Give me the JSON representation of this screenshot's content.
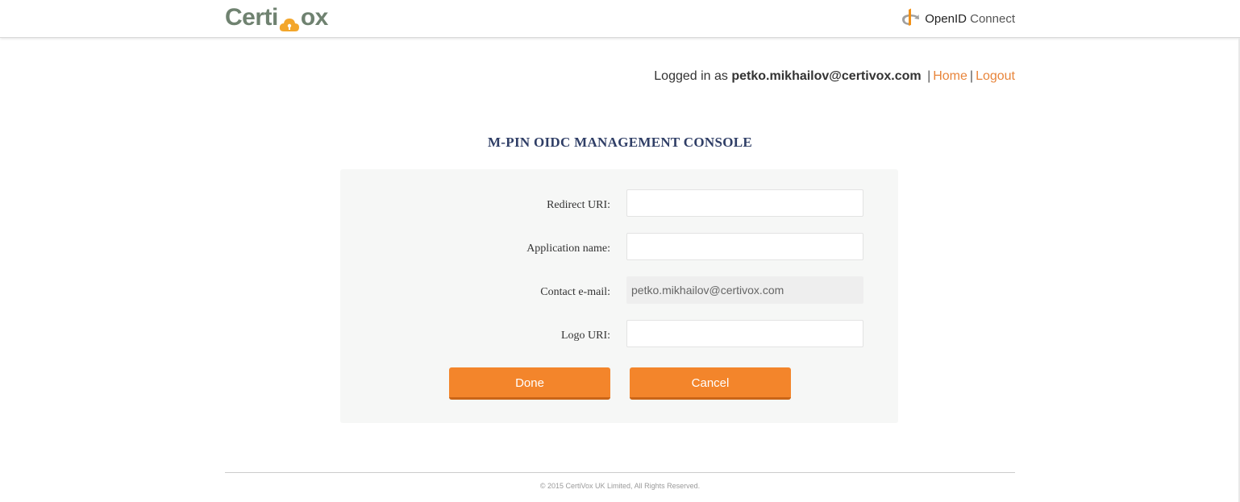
{
  "header": {
    "brand_prefix": "Certi",
    "brand_suffix": "ox",
    "brand_cloud_letter": "V",
    "brand_color": "#6f8270",
    "cloud_color": "#f3a62b",
    "openid_strong": "OpenID",
    "openid_light": "Connect"
  },
  "userbar": {
    "logged_in_prefix": "Logged in as",
    "user_email": "petko.mikhailov@certivox.com",
    "separator": "|",
    "home_link": "Home",
    "logout_link": "Logout",
    "link_color": "#e8853b"
  },
  "page": {
    "title": "M-PIN OIDC MANAGEMENT CONSOLE"
  },
  "form": {
    "fields": [
      {
        "label": "Redirect URI:",
        "value": ""
      },
      {
        "label": "Application name:",
        "value": ""
      },
      {
        "label": "Contact e-mail:",
        "value": "petko.mikhailov@certivox.com",
        "readonly": true
      },
      {
        "label": "Logo URI:",
        "value": ""
      }
    ],
    "done_label": "Done",
    "cancel_label": "Cancel",
    "button_color": "#f3852b"
  },
  "footer": {
    "copyright": "© 2015 CertiVox UK Limited, All Rights Reserved."
  }
}
